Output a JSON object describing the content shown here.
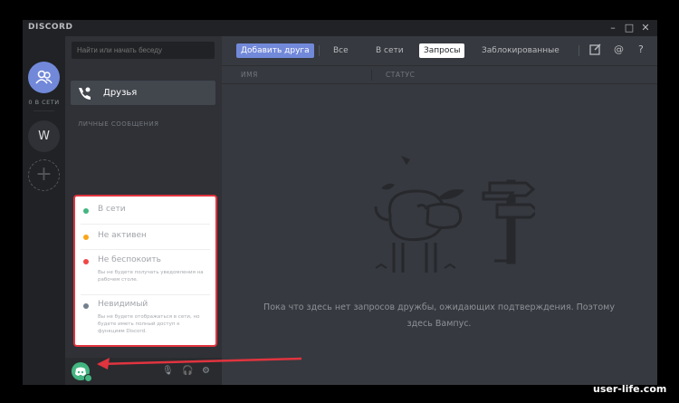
{
  "app": {
    "title": "DISCORD",
    "window_controls": [
      "–",
      "□",
      "✕"
    ]
  },
  "guilds": {
    "online_label": "0 В СЕТИ",
    "items": [
      "W"
    ],
    "add_symbol": "+"
  },
  "channels": {
    "search_placeholder": "Найти или начать беседу",
    "friends_label": "Друзья",
    "dm_header": "ЛИЧНЫЕ СООБЩЕНИЯ"
  },
  "toolbar": {
    "tabs": [
      "Добавить друга",
      "Все",
      "В сети",
      "Запросы",
      "Заблокированные"
    ],
    "active_tab": "Запросы",
    "icons": [
      "new-group-icon",
      "mention-icon",
      "help-icon"
    ]
  },
  "columns": {
    "name": "ИМЯ",
    "status": "СТАТУС"
  },
  "empty_state": {
    "line1": "Пока что здесь нет запросов дружбы, ожидающих подтверждения. Поэтому",
    "line2": "здесь Вампус."
  },
  "status_menu": {
    "items": [
      {
        "name": "В сети",
        "desc": "",
        "color": "#43b581"
      },
      {
        "name": "Не активен",
        "desc": "",
        "color": "#faa61a"
      },
      {
        "name": "Не беспокоить",
        "desc": "Вы не будете получать уведомления на рабочем столе.",
        "color": "#f04747"
      },
      {
        "name": "Невидимый",
        "desc": "Вы не будете отображаться в сети, но будете иметь полный доступ к функциям Discord.",
        "color": "#747f8d"
      }
    ]
  },
  "colors": {
    "accent": "#7289da",
    "highlight_border": "#e0343f",
    "online": "#43b581"
  },
  "watermark": "user-life.com"
}
